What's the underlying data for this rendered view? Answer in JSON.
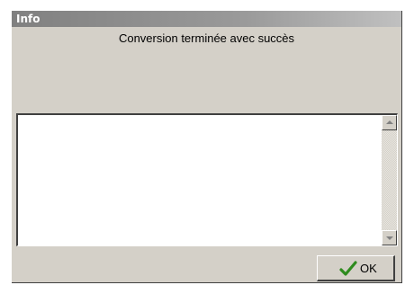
{
  "window": {
    "title": "Info"
  },
  "message": "Conversion terminée avec succès",
  "memo": {
    "text": ""
  },
  "ok_button": {
    "label": "OK",
    "icon": "checkmark-icon"
  },
  "colors": {
    "dialog_face": "#d4d0c8",
    "titlebar_start": "#808080",
    "titlebar_end": "#c0c0c0",
    "checkmark": "#2e8b1e"
  }
}
